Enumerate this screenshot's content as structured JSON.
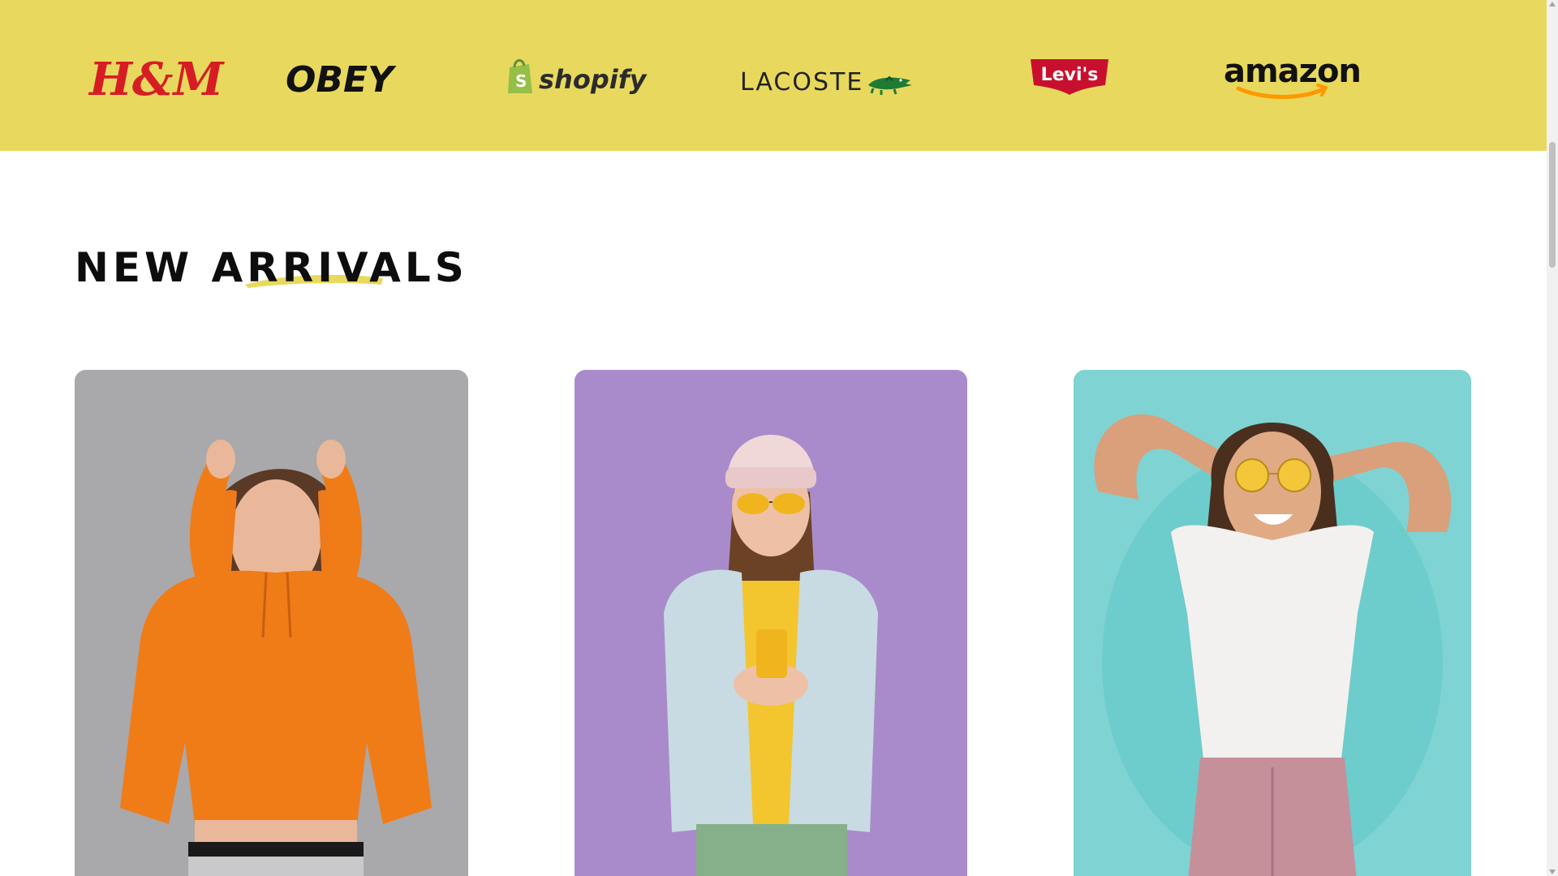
{
  "brands": [
    {
      "name": "H&M",
      "icon": "hm-logo"
    },
    {
      "name": "OBEY",
      "icon": "obey-logo"
    },
    {
      "name": "shopify",
      "icon": "shopify-logo"
    },
    {
      "name": "LACOSTE",
      "icon": "lacoste-logo"
    },
    {
      "name": "Levi's",
      "icon": "levis-logo"
    },
    {
      "name": "amazon",
      "icon": "amazon-logo"
    }
  ],
  "new_arrivals": {
    "title": "NEW ARRIVALS",
    "products": [
      {
        "photo": "woman-orange-hoodie-photo",
        "background": "#a9a8ab"
      },
      {
        "photo": "woman-denim-jacket-phone-photo",
        "background": "#a98bcb"
      },
      {
        "photo": "woman-white-tee-sunglasses-photo",
        "background": "#7fd3d3"
      }
    ]
  },
  "colors": {
    "accent": "#e8d95e",
    "title_text": "#0d0d0d"
  }
}
